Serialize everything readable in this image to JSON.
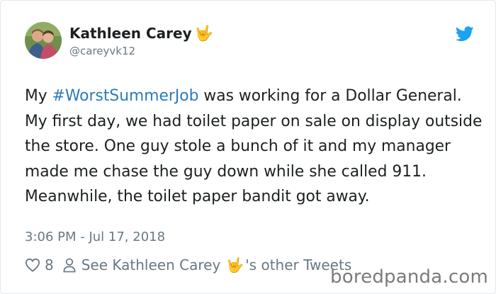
{
  "author": {
    "name": "Kathleen Carey",
    "emoji": "🤟",
    "handle": "@careyvk12"
  },
  "tweet": {
    "text_before": "My ",
    "hashtag": "#WorstSummerJob",
    "text_after": " was working for a Dollar General. My first day, we had toilet paper on sale on display outside the store. One guy stole a bunch of it and my manager made me chase the guy down while she called 911. Meanwhile, the toilet paper bandit got away.",
    "timestamp": "3:06 PM - Jul 17, 2018"
  },
  "actions": {
    "likes": "8",
    "other_tweets_prefix": "See Kathleen Carey",
    "other_tweets_emoji": "🤟",
    "other_tweets_suffix": "'s other Tweets"
  },
  "watermark": "boredpanda.com",
  "colors": {
    "link": "#2b7bb9",
    "twitter_blue": "#1da1f2",
    "muted": "#697882",
    "text": "#1c2022"
  },
  "icons": [
    "avatar",
    "twitter-bird-icon",
    "heart-icon",
    "person-icon"
  ]
}
